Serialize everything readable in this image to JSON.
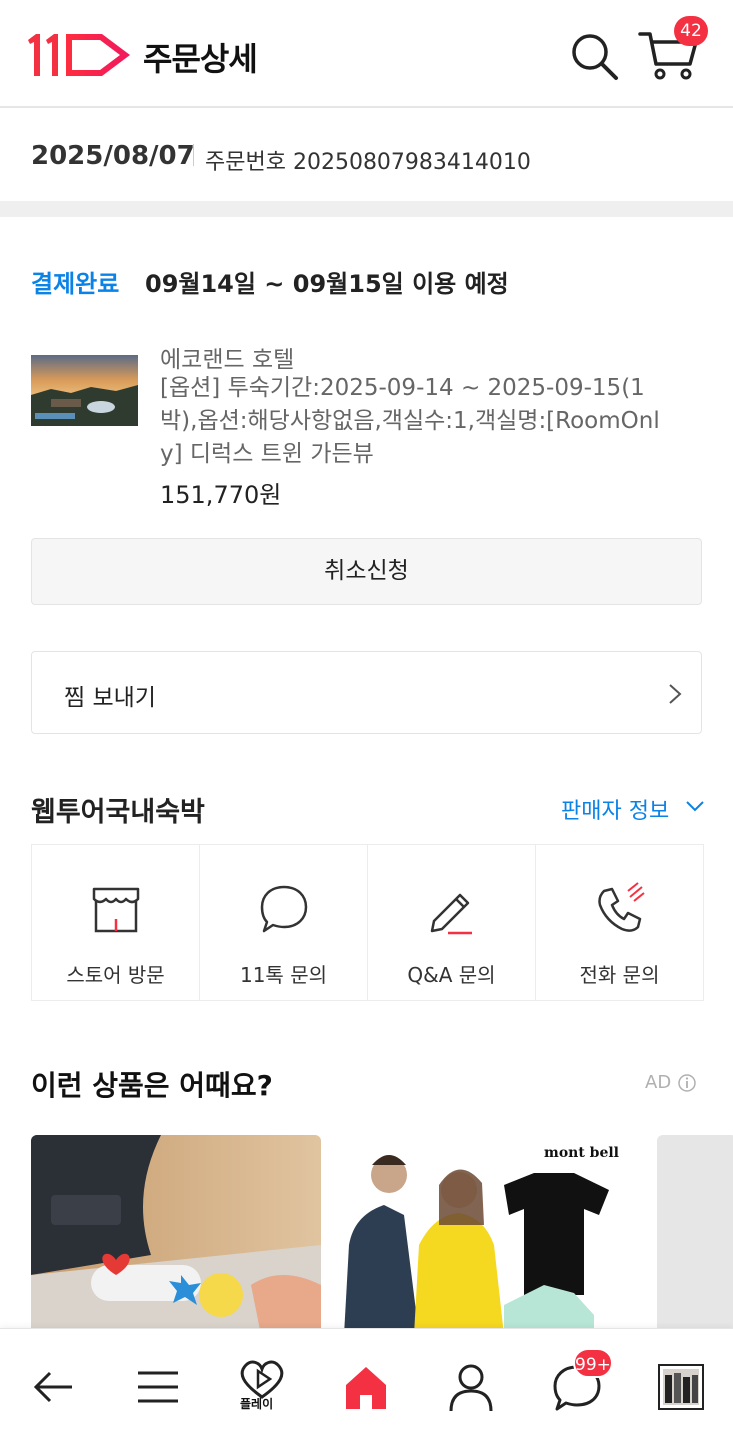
{
  "header": {
    "title": "주문상세",
    "cart_count": "42"
  },
  "order": {
    "date": "2025/08/07",
    "number_label": "주문번호 20250807983414010"
  },
  "status": {
    "paid": "결제완료",
    "period": "09월14일 ~ 09월15일 이용 예정"
  },
  "product": {
    "name": "에코랜드 호텔",
    "option": "[옵션] 투숙기간:2025-09-14 ~ 2025-09-15(1박),옵션:해당사항없음,객실수:1,객실명:[RoomOnly] 디럭스 트윈 가든뷰",
    "price": "151,770원"
  },
  "actions": {
    "cancel": "취소신청",
    "wish": "찜 보내기"
  },
  "seller": {
    "name": "웹투어국내숙박",
    "info_link": "판매자 정보",
    "contacts": [
      {
        "label": "스토어 방문",
        "icon": "store-icon"
      },
      {
        "label": "11톡 문의",
        "icon": "chat-bubble-icon"
      },
      {
        "label": "Q&A 문의",
        "icon": "pencil-icon"
      },
      {
        "label": "전화 문의",
        "icon": "phone-icon"
      }
    ]
  },
  "recommend": {
    "title": "이런 상품은 어때요?",
    "ad_label": "AD"
  },
  "bottom_nav": {
    "play_label": "플레이",
    "chat_badge": "99+"
  },
  "colors": {
    "brand_red": "#f43142",
    "link_blue": "#0b83e6"
  }
}
